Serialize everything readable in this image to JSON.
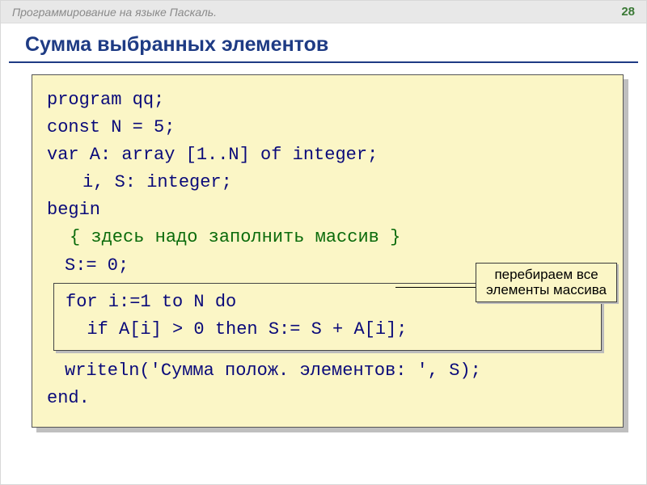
{
  "topbar": {
    "title": "Программирование на языке Паскаль.",
    "page": "28"
  },
  "heading": "Сумма выбранных элементов",
  "code": {
    "l1": "program qq;",
    "l2": "const N = 5;",
    "l3": "var A: array [1..N] of integer;",
    "l4": "i, S: integer;",
    "l5": "begin",
    "comment": "{ здесь надо заполнить массив }",
    "s0": "S:= 0;",
    "box_l1": "for i:=1 to N do",
    "box_l2": "  if A[i] > 0 then S:= S + A[i];",
    "writeln": "writeln('Сумма полож. элементов: ', S);",
    "end": "end."
  },
  "callout": {
    "line1": "перебираем все",
    "line2": "элементы массива"
  }
}
